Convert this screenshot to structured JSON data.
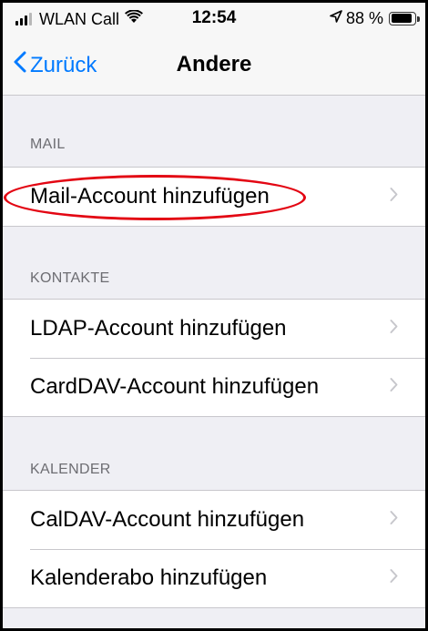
{
  "status_bar": {
    "carrier": "WLAN Call",
    "time": "12:54",
    "battery_percent": "88 %",
    "battery_level": 0.88,
    "icons": [
      "signal-icon",
      "wifi-icon",
      "location-arrow-icon",
      "battery-icon"
    ]
  },
  "nav": {
    "back_label": "Zurück",
    "title": "Andere"
  },
  "sections": [
    {
      "header": "MAIL",
      "rows": [
        {
          "label": "Mail-Account hinzufügen",
          "highlighted": true
        }
      ]
    },
    {
      "header": "KONTAKTE",
      "rows": [
        {
          "label": "LDAP-Account hinzufügen"
        },
        {
          "label": "CardDAV-Account hinzufügen"
        }
      ]
    },
    {
      "header": "KALENDER",
      "rows": [
        {
          "label": "CalDAV-Account hinzufügen"
        },
        {
          "label": "Kalenderabo hinzufügen"
        }
      ]
    }
  ],
  "colors": {
    "accent": "#007aff",
    "background": "#efeff4",
    "annotation": "#e30613"
  }
}
